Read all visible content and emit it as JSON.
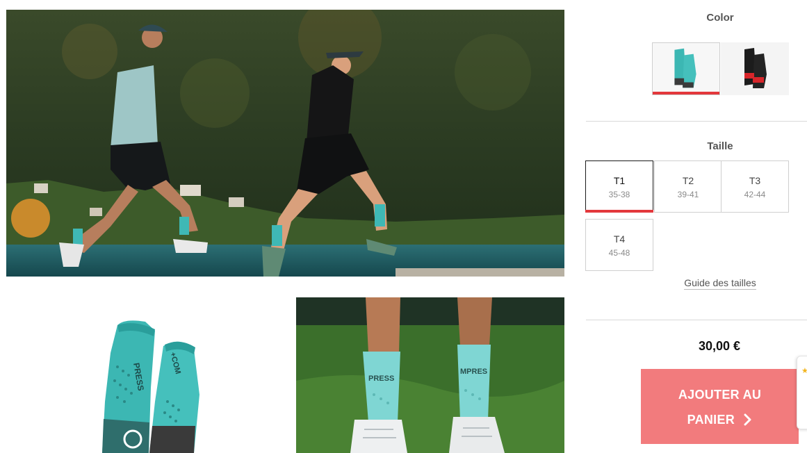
{
  "images": {
    "hero": "runners-lakeside-photo",
    "thumb_product": "teal-socks-product-photo",
    "thumb_lifestyle": "socks-on-grass-photo"
  },
  "color_selector": {
    "title": "Color",
    "options": [
      {
        "name": "teal",
        "selected": true
      },
      {
        "name": "black-red",
        "selected": false
      }
    ]
  },
  "size_selector": {
    "title": "Taille",
    "options": [
      {
        "label": "T1",
        "range": "35-38",
        "selected": true
      },
      {
        "label": "T2",
        "range": "39-41",
        "selected": false
      },
      {
        "label": "T3",
        "range": "42-44",
        "selected": false
      },
      {
        "label": "T4",
        "range": "45-48",
        "selected": false
      }
    ],
    "guide_link": "Guide des tailles"
  },
  "price": "30,00 €",
  "cart_button": {
    "line1": "AJOUTER AU",
    "line2": "PANIER",
    "icon": "chevron-right-icon"
  },
  "colors": {
    "accent": "#e3383c",
    "cart_button_bg": "#f27b7d",
    "teal": "#3fb8b5"
  },
  "side_widget_icon": "star-icon"
}
